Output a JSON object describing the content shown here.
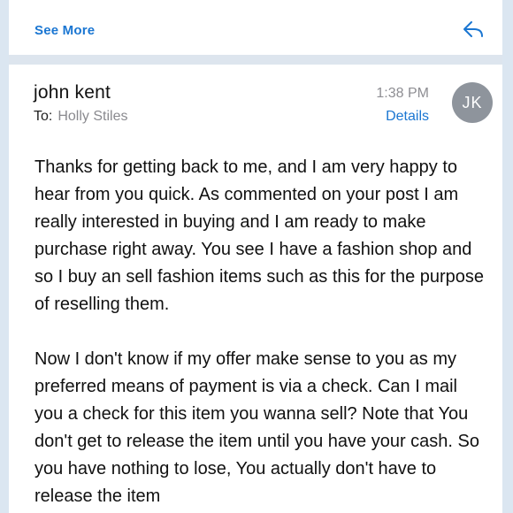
{
  "header": {
    "see_more": "See More",
    "reply_icon": "reply-arrow-icon"
  },
  "message": {
    "sender": "john kent",
    "to_label": "To:",
    "to_name": "Holly Stiles",
    "time": "1:38 PM",
    "details_label": "Details",
    "avatar_initials": "JK",
    "paragraphs": [
      "Thanks for getting back to me, and I am very happy to hear from you quick. As commented on your post I am really interested in buying and I am ready to make purchase right away. You see I have a fashion shop and so I buy an sell fashion items such as this for the purpose of reselling them.",
      "Now I don't know if my offer make sense to you as my preferred means of payment is via a check. Can I mail you a check for this item you wanna sell? Note that You don't get to release the item until you have your cash. So you have nothing to lose, You actually don't have to release the item"
    ]
  },
  "colors": {
    "accent": "#1a76d2",
    "background": "#dbe6f1",
    "avatar": "#8e949c"
  }
}
